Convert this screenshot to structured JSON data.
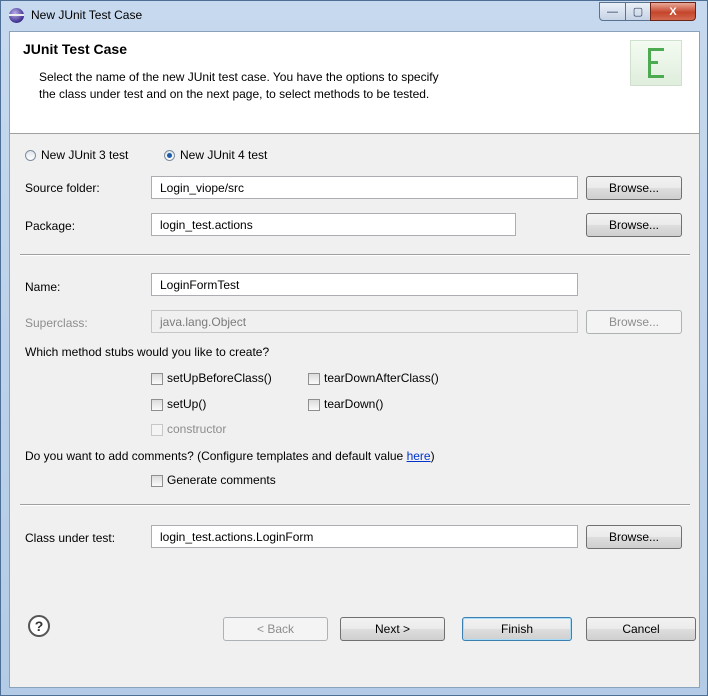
{
  "window": {
    "title": "New JUnit Test Case",
    "controls": {
      "minimize": "—",
      "maximize": "▢",
      "close": "X"
    }
  },
  "header": {
    "title": "JUnit Test Case",
    "description_line1": "Select the name of the new JUnit test case. You have the options to specify",
    "description_line2": "the class under test and on the next page, to select methods to be tested."
  },
  "version": {
    "options": [
      {
        "label": "New JUnit 3 test",
        "checked": false
      },
      {
        "label": "New JUnit 4 test",
        "checked": true
      }
    ]
  },
  "fields": {
    "source_folder": {
      "label": "Source folder:",
      "value": "Login_viope/src",
      "button": "Browse..."
    },
    "package": {
      "label": "Package:",
      "value": "login_test.actions",
      "button": "Browse..."
    },
    "name": {
      "label": "Name:",
      "value": "LoginFormTest"
    },
    "superclass": {
      "label": "Superclass:",
      "value": "java.lang.Object",
      "button": "Browse..."
    },
    "class_under_test": {
      "label": "Class under test:",
      "value": "login_test.actions.LoginForm",
      "button": "Browse..."
    }
  },
  "stubs": {
    "question": "Which method stubs would you like to create?",
    "setUpBeforeClass": "setUpBeforeClass()",
    "tearDownAfterClass": "tearDownAfterClass()",
    "setUp": "setUp()",
    "tearDown": "tearDown()",
    "constructor": "constructor"
  },
  "comments": {
    "question": "Do you want to add comments? (Configure templates and default value ",
    "link": "here",
    "closing": ")",
    "generate": "Generate comments"
  },
  "footer": {
    "help": "?",
    "back": "< Back",
    "next": "Next >",
    "finish": "Finish",
    "cancel": "Cancel"
  }
}
